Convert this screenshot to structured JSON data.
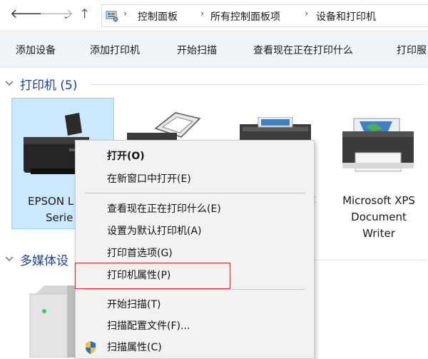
{
  "address_bar": {
    "back_icon": "arrow-left-icon",
    "forward_icon": "arrow-right-icon",
    "recent_icon": "chevron-down-icon",
    "up_icon": "arrow-up-icon",
    "location_icon": "control-panel-icon",
    "breadcrumbs": [
      "控制面板",
      "所有控制面板项",
      "设备和打印机"
    ]
  },
  "toolbar": {
    "buttons": [
      "添加设备",
      "添加打印机",
      "开始扫描",
      "查看现在正在打印什么",
      "打印服"
    ]
  },
  "groups": {
    "printers": {
      "label": "打印机 (5)"
    },
    "multimedia": {
      "label": "多媒体设"
    }
  },
  "devices": {
    "epson": {
      "line1": "EPSON L",
      "line2": "Serie"
    },
    "fax": {
      "line1": ""
    },
    "printer3": {
      "line1": "t"
    },
    "xps": {
      "line1": "Microsoft XPS",
      "line2": "Document",
      "line3": "Writer"
    }
  },
  "context_menu": {
    "items": [
      "打开(O)",
      "在新窗口中打开(E)",
      "查看现在正在打印什么(E)",
      "设置为默认打印机(A)",
      "打印首选项(G)",
      "打印机属性(P)",
      "开始扫描(T)",
      "扫描配置文件(F)...",
      "扫描属性(C)"
    ]
  },
  "colors": {
    "group_label": "#1e3f94",
    "selection": "#cce8ff",
    "highlight_box": "#e02020"
  }
}
